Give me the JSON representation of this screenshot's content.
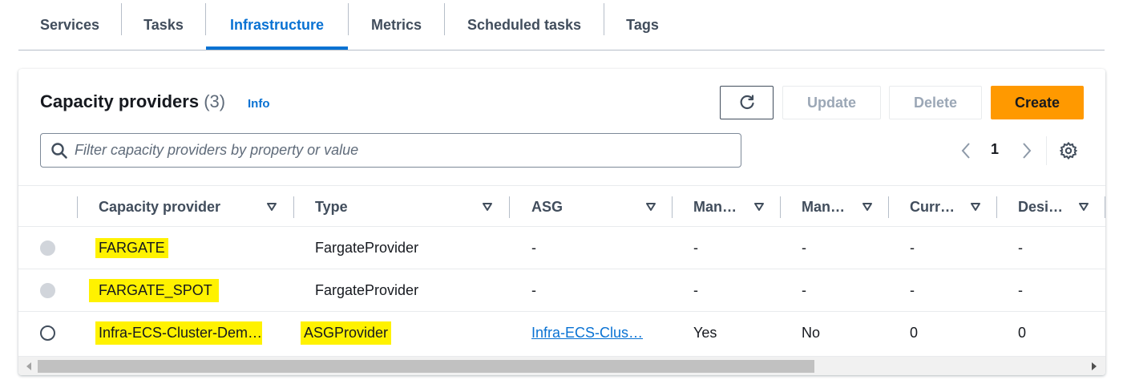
{
  "tabs": [
    {
      "label": "Services"
    },
    {
      "label": "Tasks"
    },
    {
      "label": "Infrastructure"
    },
    {
      "label": "Metrics"
    },
    {
      "label": "Scheduled tasks"
    },
    {
      "label": "Tags"
    }
  ],
  "active_tab": "Infrastructure",
  "panel": {
    "title": "Capacity providers",
    "count": "(3)",
    "info": "Info",
    "buttons": {
      "refresh_icon": "refresh-icon",
      "update": "Update",
      "delete": "Delete",
      "create": "Create"
    },
    "filter": {
      "placeholder": "Filter capacity providers by property or value",
      "value": ""
    },
    "pagination": {
      "current_page": "1"
    }
  },
  "table": {
    "columns": [
      {
        "label": "Capacity provider"
      },
      {
        "label": "Type"
      },
      {
        "label": "ASG"
      },
      {
        "label": "Man…"
      },
      {
        "label": "Man…"
      },
      {
        "label": "Curr…"
      },
      {
        "label": "Desi…"
      }
    ],
    "rows": [
      {
        "name": "FARGATE",
        "type": "FargateProvider",
        "asg": "-",
        "m1": "-",
        "m2": "-",
        "curr": "-",
        "desi": "-",
        "selectable": false
      },
      {
        "name": "FARGATE_SPOT",
        "type": "FargateProvider",
        "asg": "-",
        "m1": "-",
        "m2": "-",
        "curr": "-",
        "desi": "-",
        "selectable": false
      },
      {
        "name": "Infra-ECS-Cluster-Dem…",
        "type": "ASGProvider",
        "asg": "Infra-ECS-Clus…",
        "m1": "Yes",
        "m2": "No",
        "curr": "0",
        "desi": "0",
        "selectable": true
      }
    ]
  },
  "colors": {
    "accent": "#0972d3",
    "primary_button": "#ff9900",
    "highlight": "#fff200"
  }
}
